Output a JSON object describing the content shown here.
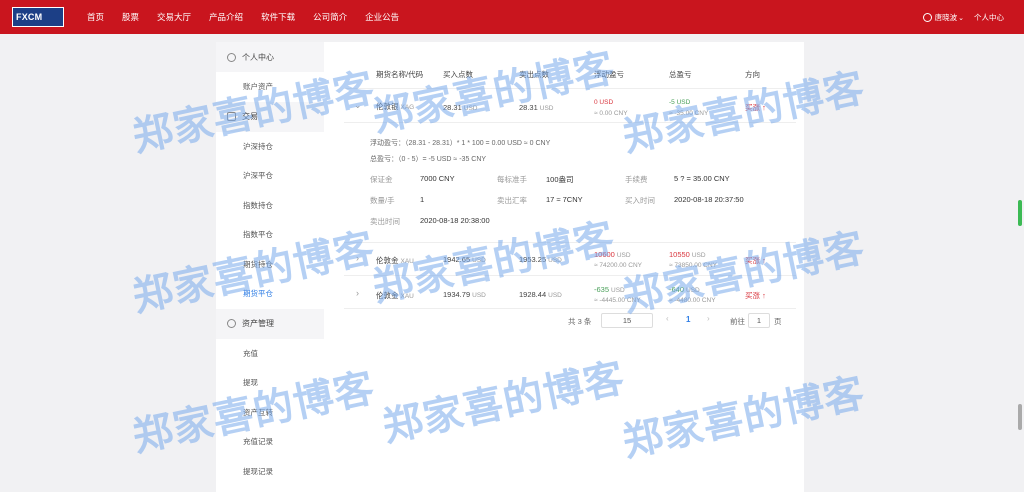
{
  "brand": {
    "logo_text": "FXCM"
  },
  "nav": [
    "首页",
    "股票",
    "交易大厅",
    "产品介绍",
    "软件下载",
    "公司简介",
    "企业公告"
  ],
  "user": {
    "name": "唐晓波",
    "center": "个人中心"
  },
  "sidebar": {
    "groups": [
      {
        "label": "个人中心",
        "items": [
          "账户资产"
        ]
      },
      {
        "label": "交易",
        "items": [
          "沪深持仓",
          "沪深平仓",
          "指数持仓",
          "指数平仓",
          "期货持仓",
          "期货平仓"
        ]
      },
      {
        "label": "资产管理",
        "items": [
          "充值",
          "提现",
          "资产互转",
          "充值记录",
          "提现记录"
        ]
      }
    ],
    "active_item": "期货平仓"
  },
  "table": {
    "headers": [
      "期货名称/代码",
      "买入点数",
      "卖出点数",
      "浮动盈亏",
      "总盈亏",
      "方向"
    ],
    "rows": [
      {
        "name": "伦敦银",
        "code": "XAG",
        "buy": "28.31",
        "buy_unit": "USD",
        "sell": "28.31",
        "sell_unit": "USD",
        "float": "0 USD",
        "float_cny": "≈ 0.00 CNY",
        "total": "-5 USD",
        "total_cny": "≈ -35.00 CNY",
        "direction": "买涨"
      },
      {
        "name": "伦敦金",
        "code": "XAU",
        "buy": "1942.65",
        "buy_unit": "USD",
        "sell": "1953.25",
        "sell_unit": "USD",
        "float": "10600",
        "float_unit": "USD",
        "float_cny": "≈ 74200.00 CNY",
        "total": "10550",
        "total_unit": "USD",
        "total_cny": "≈ 73850.00 CNY",
        "direction": "买涨"
      },
      {
        "name": "伦敦金",
        "code": "XAU",
        "buy": "1934.79",
        "buy_unit": "USD",
        "sell": "1928.44",
        "sell_unit": "USD",
        "float": "-635",
        "float_unit": "USD",
        "float_cny": "≈ -4445.00 CNY",
        "total": "-640",
        "total_unit": "USD",
        "total_cny": "≈ -4480.00 CNY",
        "direction": "买涨"
      }
    ],
    "detail": {
      "float_formula": "浮动盈亏：（28.31 - 28.31）* 1 * 100 = 0.00 USD ≈ 0 CNY",
      "total_formula": "总盈亏：（0 - 5）= -5 USD ≈ -35 CNY",
      "fields": [
        {
          "label": "保证金",
          "value": "7000 CNY"
        },
        {
          "label": "每标准手",
          "value": "100盎司"
        },
        {
          "label": "手续费",
          "value": "5 ? = 35.00 CNY"
        },
        {
          "label": "数量/手",
          "value": "1"
        },
        {
          "label": "卖出汇率",
          "value": "17 ≈ 7CNY"
        },
        {
          "label": "买入时间",
          "value": "2020-08-18 20:37:50"
        },
        {
          "label": "卖出时间",
          "value": "2020-08-18 20:38:00"
        }
      ]
    }
  },
  "pagination": {
    "total": "共 3 条",
    "page_size": "15",
    "current": "1",
    "goto_label": "前往",
    "goto_value": "1",
    "page_suffix": "页",
    "prev": "‹",
    "next": "›"
  },
  "watermark": "郑家喜的博客",
  "colors": {
    "topbar": "#c9151e",
    "active": "#2f7ee5",
    "up": "#d9363e",
    "down": "#4aa05a"
  }
}
